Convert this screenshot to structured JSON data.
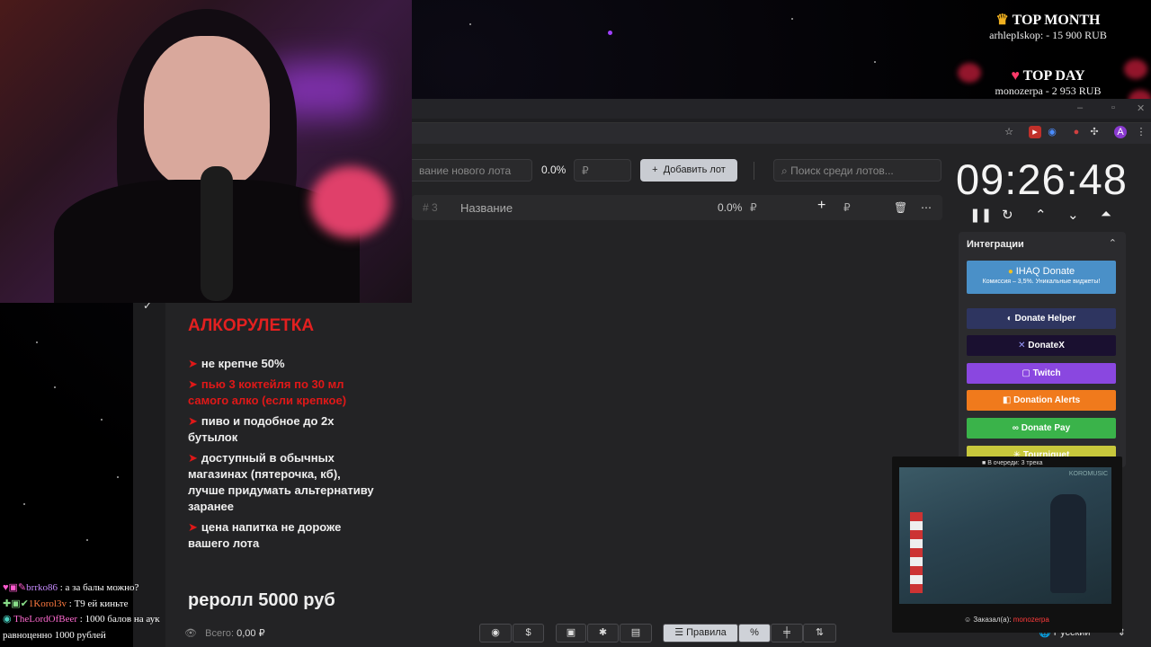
{
  "top_month": {
    "title": "TOP MONTH",
    "entry": "arhlepIskop: - 15 900 RUB",
    "icon": "crown-icon"
  },
  "top_day": {
    "title": "TOP DAY",
    "entry": "monozerpa - 2 953 RUB",
    "icon": "heart-icon"
  },
  "lot_form": {
    "name_placeholder": "вание нового лота",
    "percent": "0.0%",
    "currency_placeholder": "₽",
    "add_button": "Добавить лот",
    "search_placeholder": "Поиск среди лотов..."
  },
  "lot_row": {
    "index": "# 3",
    "name": "Название",
    "percent": "0.0%",
    "currency": "₽",
    "plus_currency": "₽"
  },
  "rules": {
    "title": "АЛКОРУЛЕТКА",
    "items": [
      {
        "text": "не крепче 50%",
        "red": false
      },
      {
        "text": "пью 3 коктейля по 30 мл самого алко (если крепкое)",
        "red": true
      },
      {
        "text": "пиво и подобное до 2х бутылок",
        "red": false
      },
      {
        "text": "доступный в обычных магазинах (пятерочка, кб), лучше придумать альтернативу заранее",
        "red": false
      },
      {
        "text": "цена напитка не дороже вашего лота",
        "red": false
      }
    ],
    "reroll": "реролл 5000 руб"
  },
  "total": {
    "label": "Всего:",
    "value": "0,00 ₽"
  },
  "toolbar": {
    "rules_label": "Правила",
    "percent_label": "%"
  },
  "language": "Русский",
  "timer": "09:26:48",
  "integrations": {
    "title": "Интеграции",
    "items": [
      {
        "label": "IHAQ Donate",
        "sub": "Комиссия – 3,5%. Уникальные виджеты!",
        "color": "#4a90c8"
      },
      {
        "label": "Donate Helper",
        "color": "#2e3560"
      },
      {
        "label": "DonateX",
        "color": "#1a1030"
      },
      {
        "label": "Twitch",
        "color": "#8a47e0"
      },
      {
        "label": "Donation Alerts",
        "color": "#f07a1c"
      },
      {
        "label": "Donate Pay",
        "color": "#3ab34a"
      },
      {
        "label": "Tourniquet",
        "color": "#c8c83c"
      }
    ]
  },
  "video": {
    "queue_text": "В очереди: 3 трека",
    "brand": "KOROMUSIC",
    "ordered_label": "Заказал(а):",
    "ordered_by": "monozerpa"
  },
  "chat": [
    {
      "user": "brrko86",
      "message": "а за балы можно?"
    },
    {
      "user": "1Korol3v",
      "message": "Т9 ей киньте"
    },
    {
      "user": "TheLordOfBeer",
      "message": "1000 балов на аук равноценно 1000 рублей"
    }
  ]
}
